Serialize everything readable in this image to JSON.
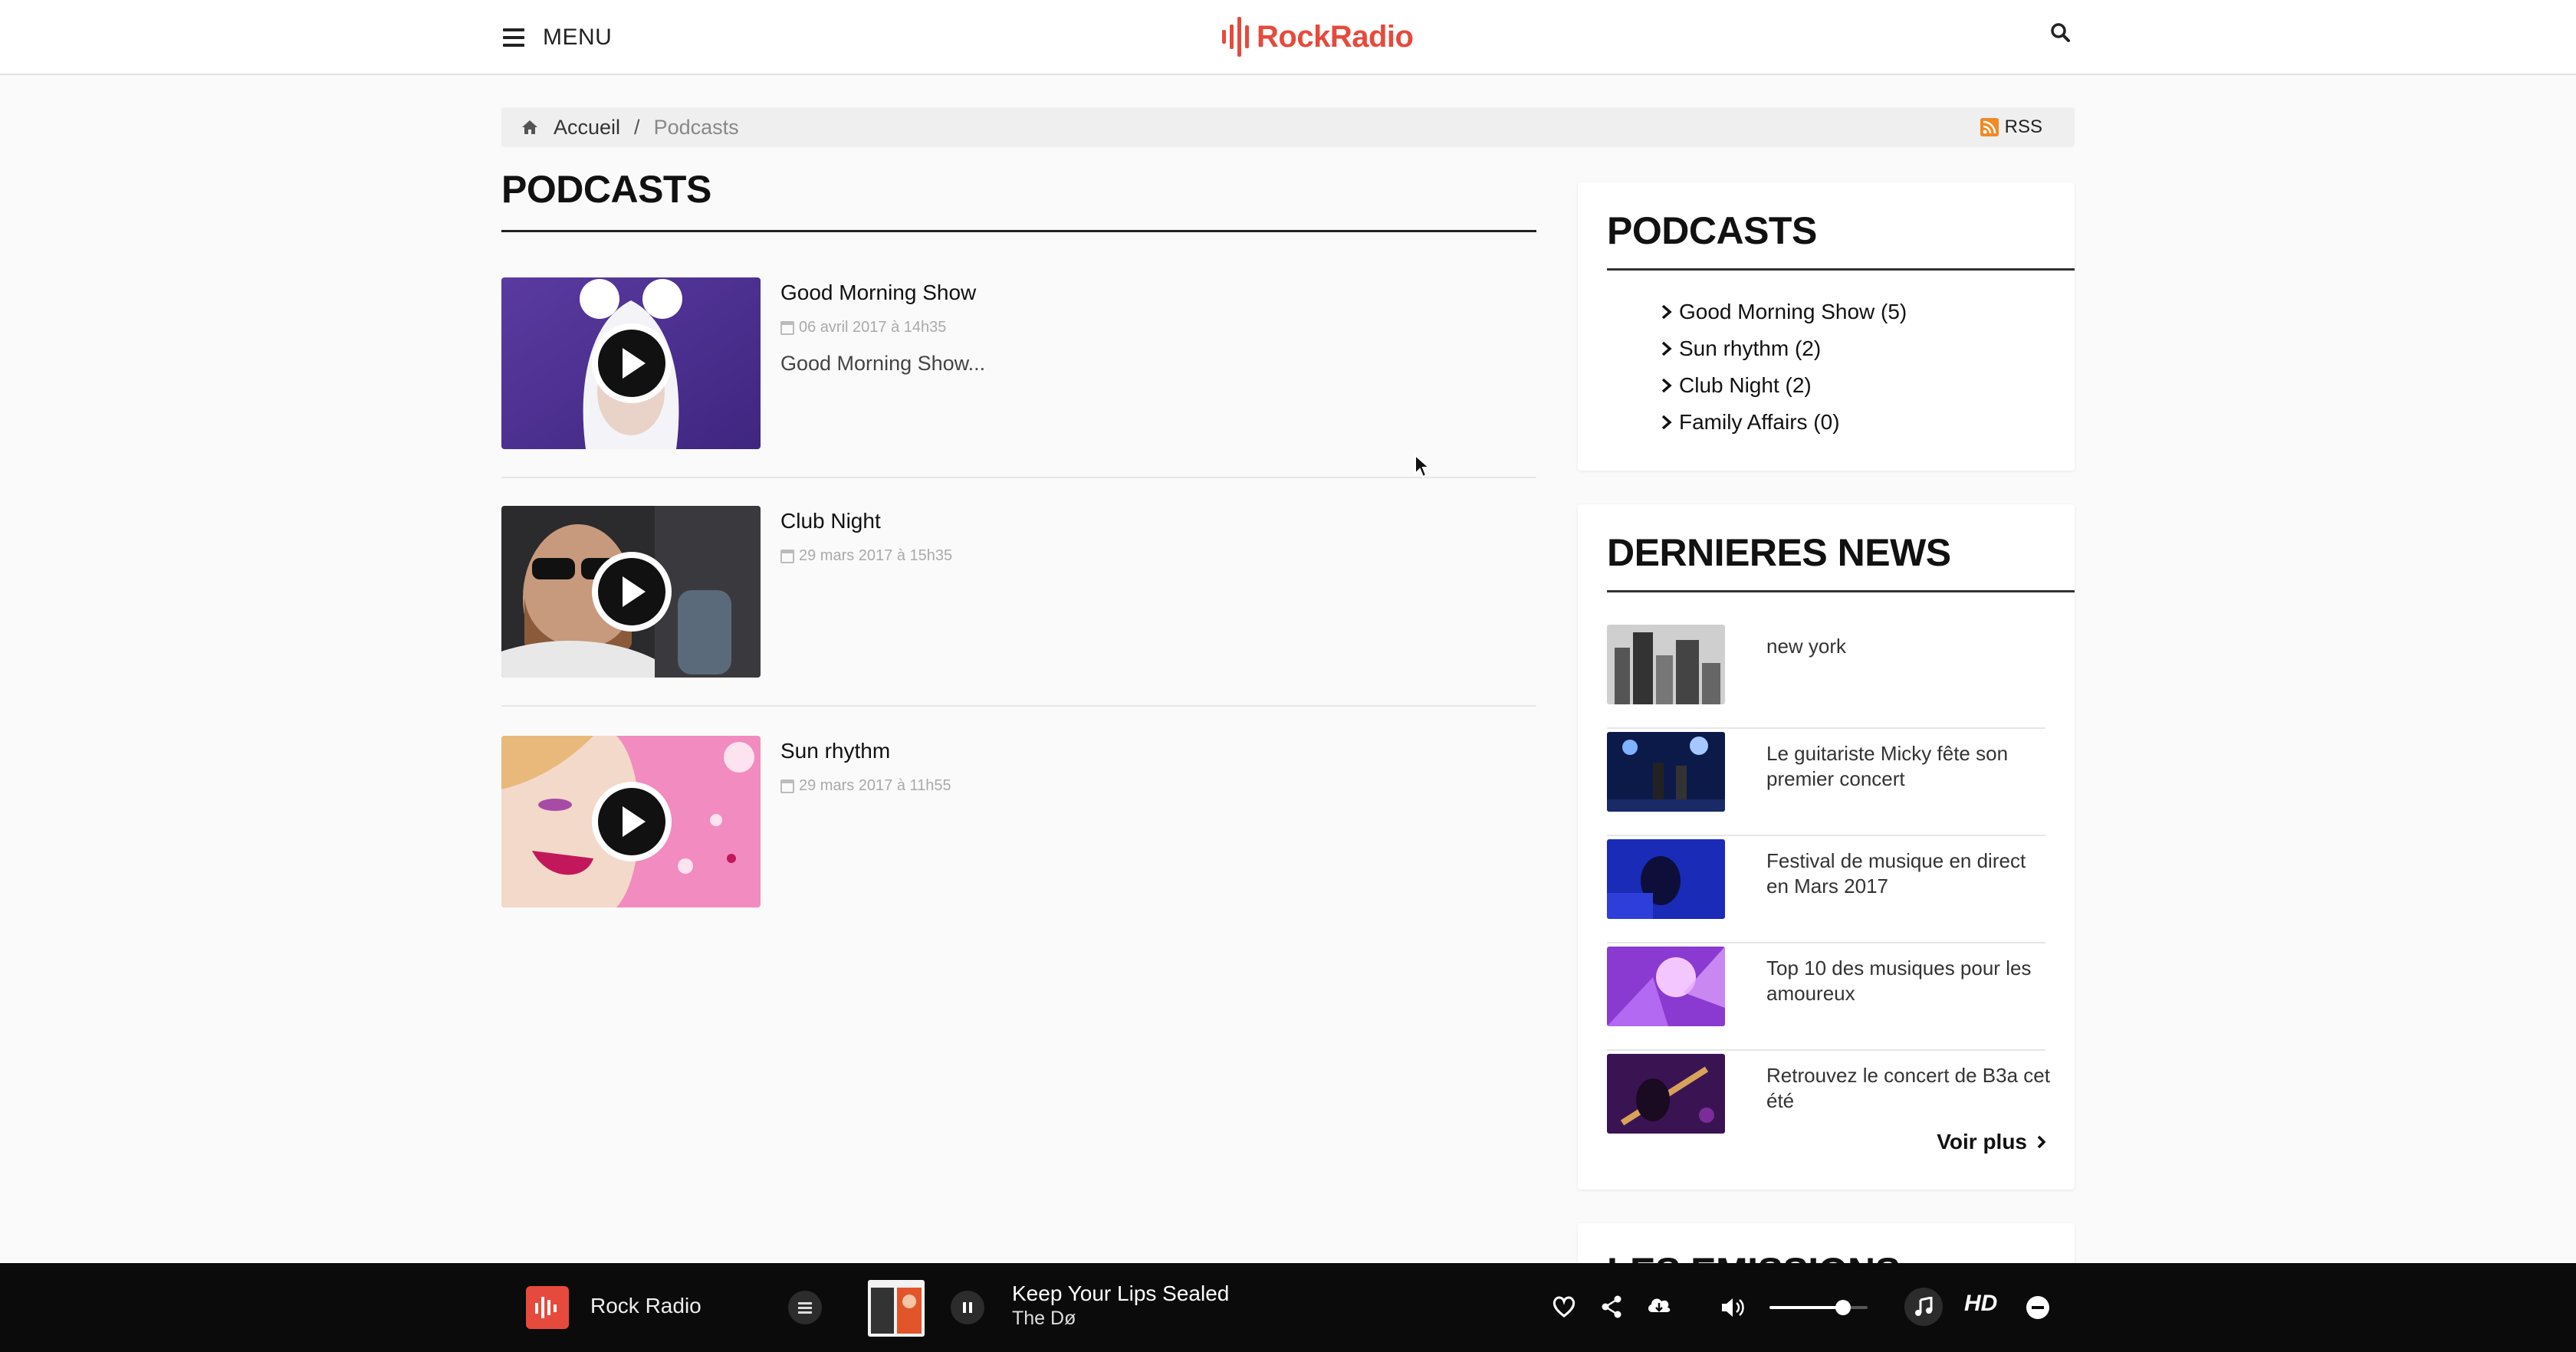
{
  "header": {
    "menu_label": "MENU",
    "logo_text": "RockRadio"
  },
  "breadcrumb": {
    "home": "Accueil",
    "separator": "/",
    "current": "Podcasts",
    "rss": "RSS"
  },
  "main": {
    "title": "PODCASTS",
    "podcasts": [
      {
        "title": "Good Morning Show",
        "date": "06 avril 2017 à 14h35",
        "description": "Good Morning Show..."
      },
      {
        "title": "Club Night",
        "date": "29 mars 2017 à 15h35",
        "description": ""
      },
      {
        "title": "Sun rhythm",
        "date": "29 mars 2017 à 11h55",
        "description": ""
      }
    ]
  },
  "sidebar": {
    "podcasts_widget": {
      "title": "PODCASTS",
      "categories": [
        "Good Morning Show (5)",
        "Sun rhythm (2)",
        "Club Night (2)",
        "Family Affairs (0)"
      ]
    },
    "news_widget": {
      "title": "DERNIERES NEWS",
      "items": [
        "new york",
        "Le guitariste Micky fête son premier concert",
        "Festival de musique en direct en Mars 2017",
        "Top 10 des musiques pour les amoureux",
        "Retrouvez le concert de B3a cet été"
      ],
      "more_label": "Voir plus"
    },
    "emissions_widget": {
      "title": "LES EMISSIONS"
    }
  },
  "player": {
    "station": "Rock Radio",
    "track_title": "Keep Your Lips Sealed",
    "track_artist": "The Dø",
    "quality_label": "HD",
    "volume": 0.75
  },
  "colors": {
    "brand": "#e64a3c",
    "player_bg": "#0b0b0b"
  }
}
